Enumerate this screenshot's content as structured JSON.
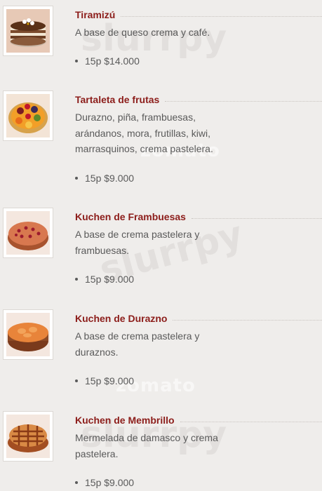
{
  "items": [
    {
      "title": "Tiramizú",
      "description": "A base de queso crema y café.",
      "price": "15p $14.000",
      "image_icon": "tiramisu-cake-image"
    },
    {
      "title": "Tartaleta de frutas",
      "description": "Durazno, piña, frambuesas, arándanos, mora, frutillas, kiwi, marrasquinos, crema pastelera.",
      "price": "15p $9.000",
      "image_icon": "fruit-tart-image"
    },
    {
      "title": "Kuchen de Frambuesas",
      "description": "A base de crema pastelera y frambuesas.",
      "price": "15p $9.000",
      "image_icon": "raspberry-kuchen-image"
    },
    {
      "title": "Kuchen de Durazno",
      "description": "A base de crema pastelera y duraznos.",
      "price": "15p $9.000",
      "image_icon": "peach-kuchen-image"
    },
    {
      "title": "Kuchen de Membrillo",
      "description": "Mermelada de damasco y crema pastelera.",
      "price": "15p $9.000",
      "image_icon": "quince-kuchen-image"
    }
  ],
  "watermarks": {
    "slurpy": "slurrpy",
    "zomato": "zomato"
  },
  "colors": {
    "title": "#8c1d1a",
    "text": "#5a5a5a",
    "background": "#efedeb"
  }
}
